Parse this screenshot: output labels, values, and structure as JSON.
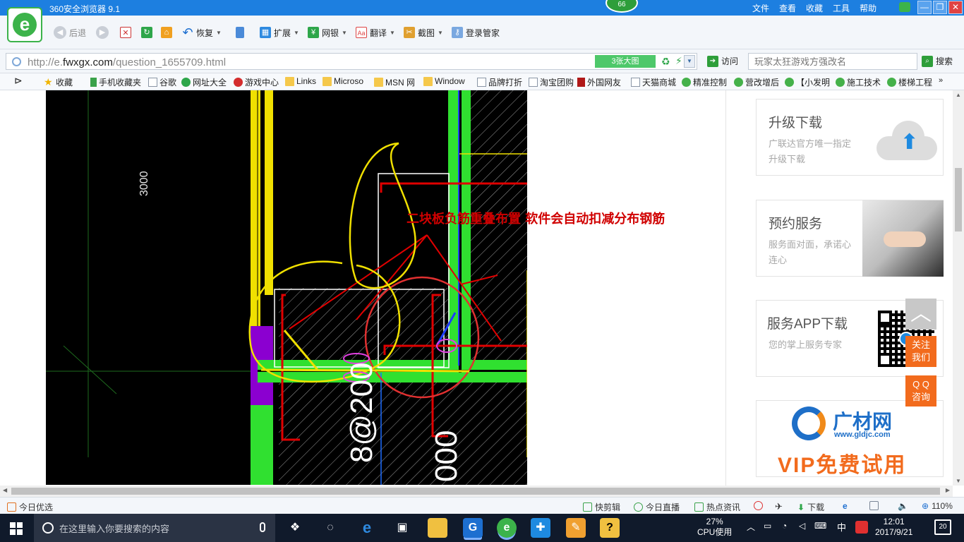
{
  "browser": {
    "title": "360安全浏览器 9.1",
    "badge": "66",
    "menus": [
      "文件",
      "查看",
      "收藏",
      "工具",
      "帮助"
    ],
    "window_buttons": {
      "minimize": "—",
      "maximize": "❐",
      "close": "✕"
    }
  },
  "toolbar": {
    "back": "后退",
    "restore": "恢复",
    "extend": "扩展",
    "bank": "网银",
    "translate": "翻译",
    "screenshot": "截图",
    "login": "登录管家"
  },
  "address": {
    "url_prefix": "http://e.",
    "url_domain": "fwxgx.com",
    "url_path": "/question_1655709.html",
    "images_button": "3张大图",
    "visit": "访问",
    "search_placeholder": "玩家太狂游戏方强改名",
    "search": "搜索"
  },
  "bookmarks": [
    "收藏",
    "手机收藏夹",
    "谷歌",
    "网址大全",
    "游戏中心",
    "Links",
    "Microso",
    "MSN 网",
    "Window",
    "品牌打折",
    "淘宝团购",
    "外国网友",
    "天猫商城",
    "精准控制",
    "营改增后",
    "【小发明",
    "施工技术",
    "楼梯工程"
  ],
  "content": {
    "cad_annotation": "二块板负筋重叠布置 软件会自动扣减分布钢筋",
    "cad_dimension": "3000",
    "cad_label_1": "8@200",
    "cad_label_2": "000"
  },
  "sidebar": {
    "upgrade": {
      "title": "升级下载",
      "subtitle": "广联达官方唯一指定升级下载"
    },
    "booking": {
      "title": "预约服务",
      "subtitle": "服务面对面，承诺心连心"
    },
    "app": {
      "title": "服务APP下载",
      "subtitle": "您的掌上服务专家"
    },
    "gcai": {
      "name": "广材网",
      "url": "www.gldjc.com",
      "vip": "VIP免费试用"
    },
    "back_top": "︿",
    "follow": "关注\n我们",
    "qq": "Q Q\n咨询"
  },
  "statusbar": {
    "left": "今日优选",
    "quick_cut": "快剪辑",
    "today_live": "今日直播",
    "hot_news": "热点资讯",
    "download": "下载",
    "zoom": "110%"
  },
  "taskbar": {
    "search_placeholder": "在这里输入你要搜索的内容",
    "cpu_percent": "27%",
    "cpu_label": "CPU使用",
    "ime": "中",
    "time": "12:01",
    "date": "2017/9/21",
    "notifications": "20"
  },
  "colors": {
    "titlebar": "#1d7fe0",
    "accent_green": "#3cb34a",
    "annotation_red": "#d00000",
    "brand_orange": "#f26b1d",
    "taskbar": "#101a2b"
  }
}
